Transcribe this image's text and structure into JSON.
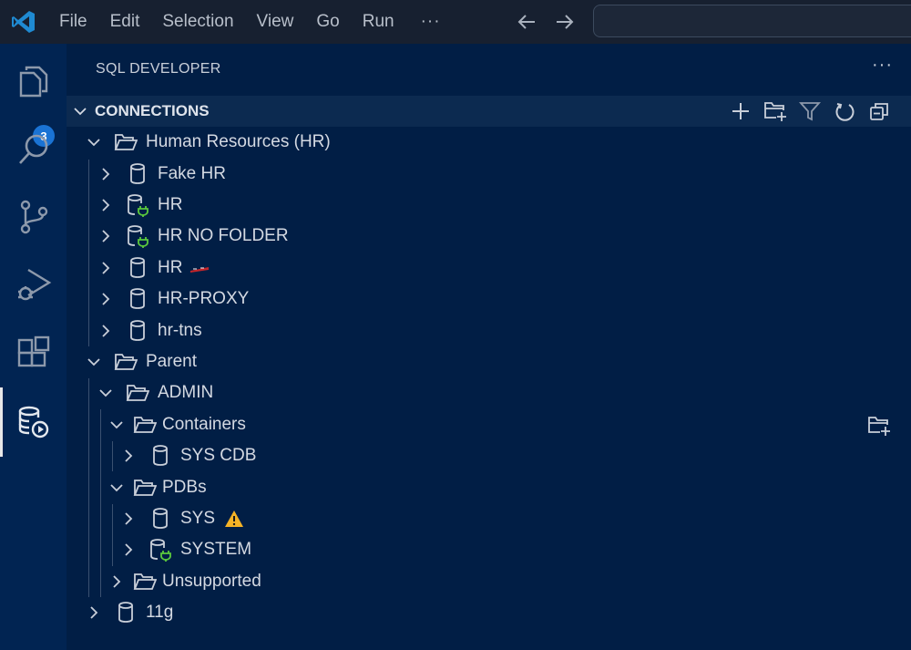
{
  "menu": {
    "file": "File",
    "edit": "Edit",
    "selection": "Selection",
    "view": "View",
    "go": "Go",
    "run": "Run",
    "more": "···"
  },
  "activity": {
    "explorer_badge": "3",
    "icons": [
      "explorer-icon",
      "search-icon",
      "source-control-icon",
      "run-debug-icon",
      "extensions-icon",
      "sql-developer-icon"
    ]
  },
  "sidebar": {
    "title": "SQL DEVELOPER",
    "more": "···",
    "section_title": "CONNECTIONS",
    "section_actions": [
      "add-connection-icon",
      "new-folder-icon",
      "filter-icon",
      "refresh-icon",
      "collapse-all-icon"
    ]
  },
  "tree": {
    "human_resources": "Human Resources (HR)",
    "fake_hr": "Fake HR",
    "hr_connected": "HR",
    "hr_no_folder": "HR NO FOLDER",
    "hr_flag": "HR",
    "hr_proxy": "HR-PROXY",
    "hr_tns": "hr-tns",
    "parent": "Parent",
    "admin": "ADMIN",
    "containers": "Containers",
    "sys_cdb": "SYS CDB",
    "pdbs": "PDBs",
    "sys": "SYS",
    "system": "SYSTEM",
    "unsupported": "Unsupported",
    "g11": "11g"
  },
  "colors": {
    "background": "#011e45",
    "activity_bar": "#012452",
    "title_bar": "#172030",
    "connected_plug": "#5cc93d",
    "warning": "#f5b326",
    "badge": "#1a73d4"
  }
}
